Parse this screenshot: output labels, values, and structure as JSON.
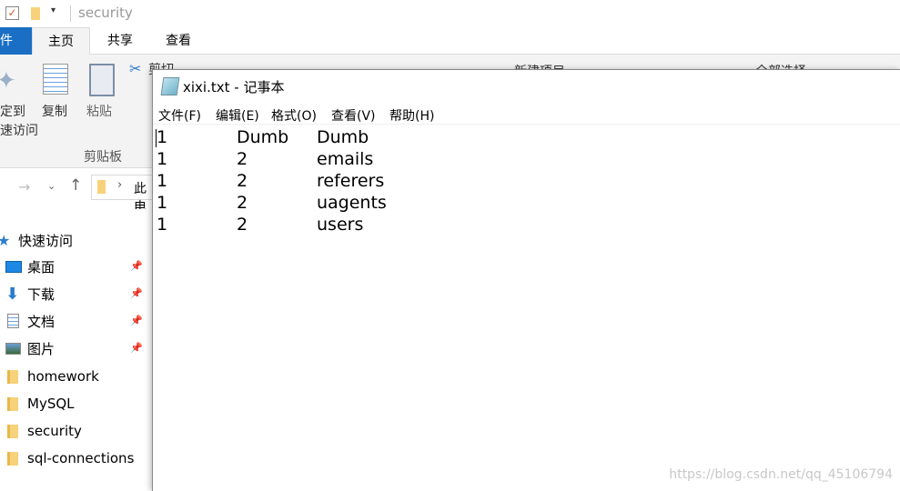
{
  "explorer": {
    "title": "security",
    "tabs": [
      {
        "label": "件",
        "active_file": true
      },
      {
        "label": "主页"
      },
      {
        "label": "共享"
      },
      {
        "label": "查看"
      }
    ],
    "ribbon": {
      "pin_label_1": "定到",
      "pin_label_2": "速访问",
      "copy": "复制",
      "paste": "粘贴",
      "cut": "剪切",
      "group_clipboard": "剪贴板",
      "new_item": "新建项目",
      "select_all": "全部选择"
    },
    "address": "此电",
    "nav": {
      "quick_access": "快速访问",
      "items": [
        {
          "label": "桌面",
          "icon": "desktop-icon",
          "pinned": true
        },
        {
          "label": "下载",
          "icon": "download-icon",
          "pinned": true
        },
        {
          "label": "文档",
          "icon": "document-icon",
          "pinned": true
        },
        {
          "label": "图片",
          "icon": "pictures-icon",
          "pinned": true
        },
        {
          "label": "homework",
          "icon": "folder-icon"
        },
        {
          "label": "MySQL",
          "icon": "folder-icon"
        },
        {
          "label": "security",
          "icon": "folder-icon"
        },
        {
          "label": "sql-connections",
          "icon": "folder-icon"
        }
      ]
    }
  },
  "notepad": {
    "title": "xixi.txt - 记事本",
    "menu": [
      "文件(F)",
      "编辑(E)",
      "格式(O)",
      "查看(V)",
      "帮助(H)"
    ],
    "lines": [
      [
        "1",
        "Dumb",
        "Dumb"
      ],
      [
        "1",
        "2",
        "emails"
      ],
      [
        "1",
        "2",
        "referers"
      ],
      [
        "1",
        "2",
        "uagents"
      ],
      [
        "1",
        "2",
        "users"
      ]
    ]
  },
  "watermark": "https://blog.csdn.net/qq_45106794",
  "colors": {
    "file_tab": "#1a6fc4",
    "folder": "#f7d27a"
  }
}
